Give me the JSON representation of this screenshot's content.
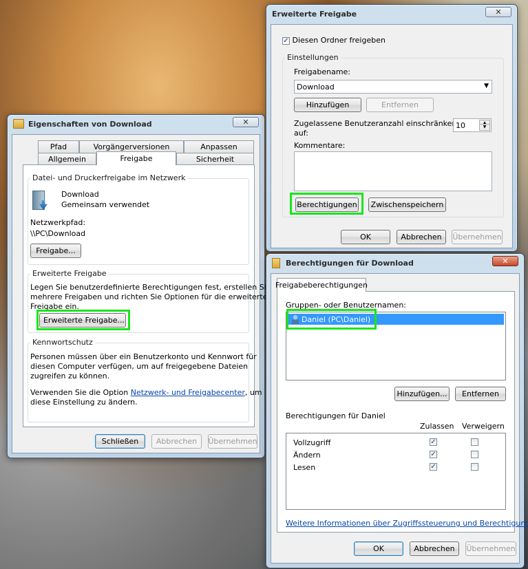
{
  "win_eigenschaften": {
    "title": "Eigenschaften von Download",
    "close": "✕",
    "tabs_row1": [
      "Pfad",
      "Vorgängerversionen",
      "Anpassen"
    ],
    "tabs_row2": [
      "Allgemein",
      "Freigabe",
      "Sicherheit"
    ],
    "group1_label": "Datei- und Druckerfreigabe im Netzwerk",
    "share_name": "Download",
    "share_status": "Gemeinsam verwendet",
    "netpath_label": "Netzwerkpfad:",
    "netpath_value": "\\\\PC\\Download",
    "freigabe_button": "Freigabe...",
    "group2_label": "Erweiterte Freigabe",
    "group2_text1": "Legen Sie benutzerdefinierte Berechtigungen fest, erstellen Sie",
    "group2_text2": "mehrere Freigaben und richten Sie Optionen für die erweiterte",
    "group2_text3": "Freigabe ein.",
    "adv_share_button": "Erweiterte Freigabe...",
    "group3_label": "Kennwortschutz",
    "group3_text1": "Personen müssen über ein Benutzerkonto und Kennwort für",
    "group3_text2": "diesen Computer verfügen, um auf freigegebene Dateien",
    "group3_text3": "zugreifen zu können.",
    "group3_text4_pre": "Verwenden Sie die Option ",
    "group3_link": "Netzwerk- und Freigabecenter",
    "group3_text4_post": ", um",
    "group3_text5": "diese Einstellung zu ändern.",
    "btn_close": "Schließen",
    "btn_cancel": "Abbrechen",
    "btn_apply": "Übernehmen"
  },
  "win_erweitert": {
    "title": "Erweiterte Freigabe",
    "close": "✕",
    "share_checkbox_label": "Diesen Ordner freigeben",
    "share_checked": true,
    "settings_label": "Einstellungen",
    "share_name_label": "Freigabename:",
    "share_name_value": "Download",
    "btn_add": "Hinzufügen",
    "btn_remove": "Entfernen",
    "limit_label_1": "Zugelassene Benutzeranzahl einschränken",
    "limit_label_2": "auf:",
    "limit_value": "10",
    "comments_label": "Kommentare:",
    "comments_value": "",
    "btn_permissions": "Berechtigungen",
    "btn_cache": "Zwischenspeichern",
    "btn_ok": "OK",
    "btn_cancel": "Abbrechen",
    "btn_apply": "Übernehmen"
  },
  "win_berechtigungen": {
    "title": "Berechtigungen für Download",
    "close": "✕",
    "tab": "Freigabeberechtigungen",
    "groups_label": "Gruppen- oder Benutzernamen:",
    "users": [
      "Daniel (PC\\Daniel)"
    ],
    "btn_add": "Hinzufügen...",
    "btn_remove": "Entfernen",
    "perm_label": "Berechtigungen für Daniel",
    "col_allow": "Zulassen",
    "col_deny": "Verweigern",
    "permissions": [
      {
        "name": "Vollzugriff",
        "allow": true,
        "deny": false
      },
      {
        "name": "Ändern",
        "allow": true,
        "deny": false
      },
      {
        "name": "Lesen",
        "allow": true,
        "deny": false
      }
    ],
    "info_link": "Weitere Informationen über Zugriffssteuerung und Berechtigungen",
    "btn_ok": "OK",
    "btn_cancel": "Abbrechen",
    "btn_apply": "Übernehmen"
  },
  "colors": {
    "highlight": "#19e619",
    "selection": "#3399ff",
    "link": "#0645ad"
  }
}
